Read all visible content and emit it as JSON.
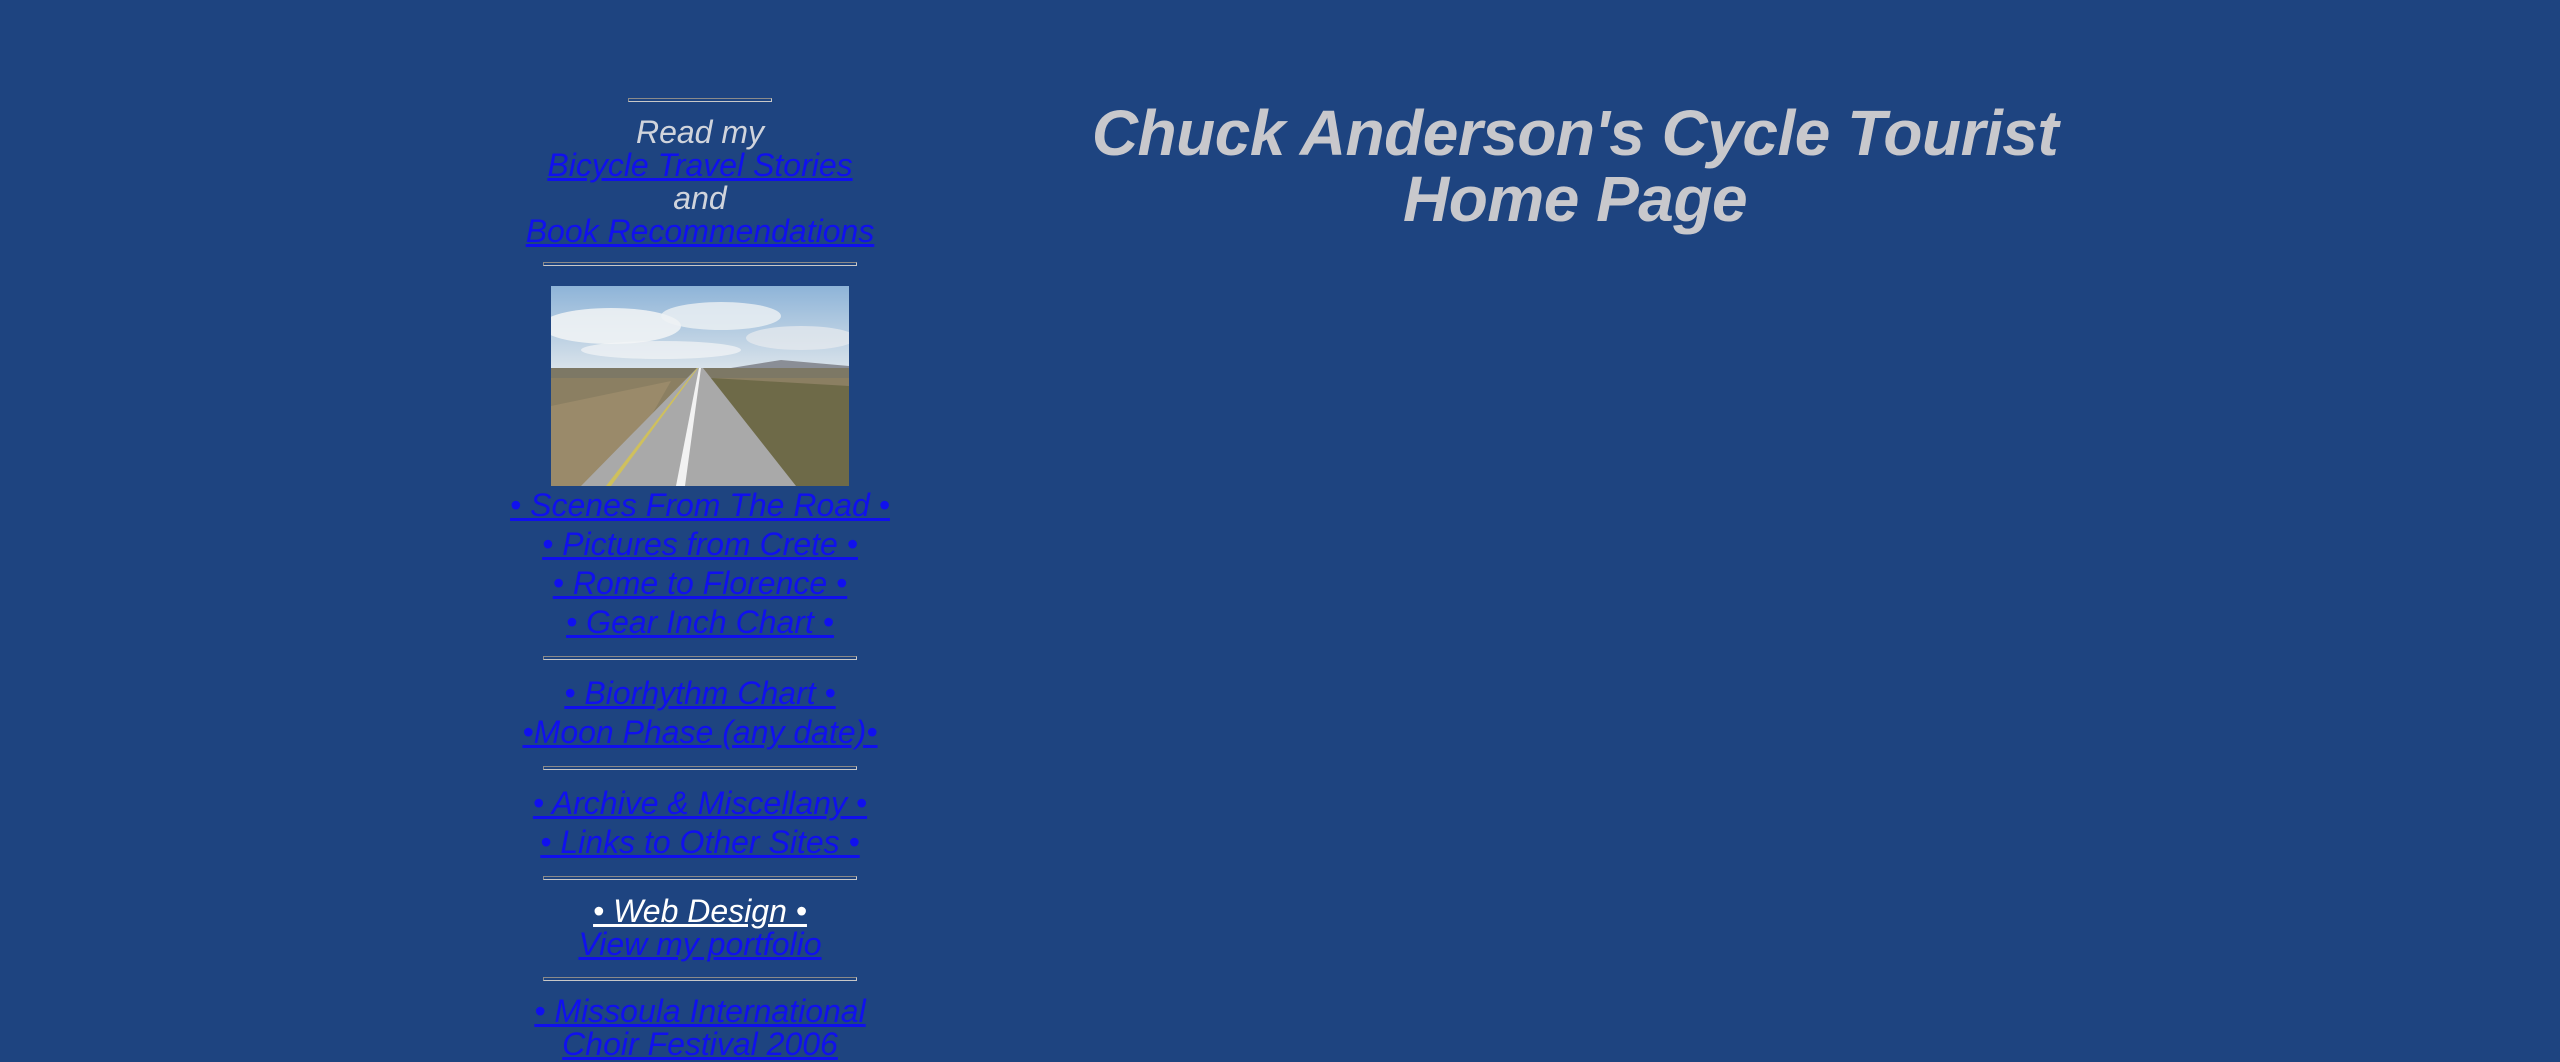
{
  "page": {
    "title": "Chuck Anderson's Cycle Tourist Home Page"
  },
  "sidebar": {
    "intro": {
      "read_my": "Read my",
      "travel_stories": "Bicycle Travel Stories",
      "and": "and",
      "book_recs": "Book Recommendations"
    },
    "photo_alt": "Long straight road across open plains",
    "group1": [
      "• Scenes From The Road •",
      "• Pictures from Crete •",
      "• Rome to Florence •",
      "• Gear Inch Chart •"
    ],
    "group2": [
      "• Biorhythm Chart •",
      "•Moon Phase (any date)•"
    ],
    "group3": [
      "• Archive & Miscellany •",
      "• Links to Other Sites •"
    ],
    "web_design": {
      "heading": "• Web Design •",
      "portfolio": "View my portfolio"
    },
    "festival": {
      "line1": "• Missoula International",
      "line2": "Choir Festival 2006"
    }
  },
  "colors": {
    "background": "#1e4480",
    "link": "#1010ee",
    "title": "#c8c8cc",
    "light_text": "#d0d4dc"
  }
}
